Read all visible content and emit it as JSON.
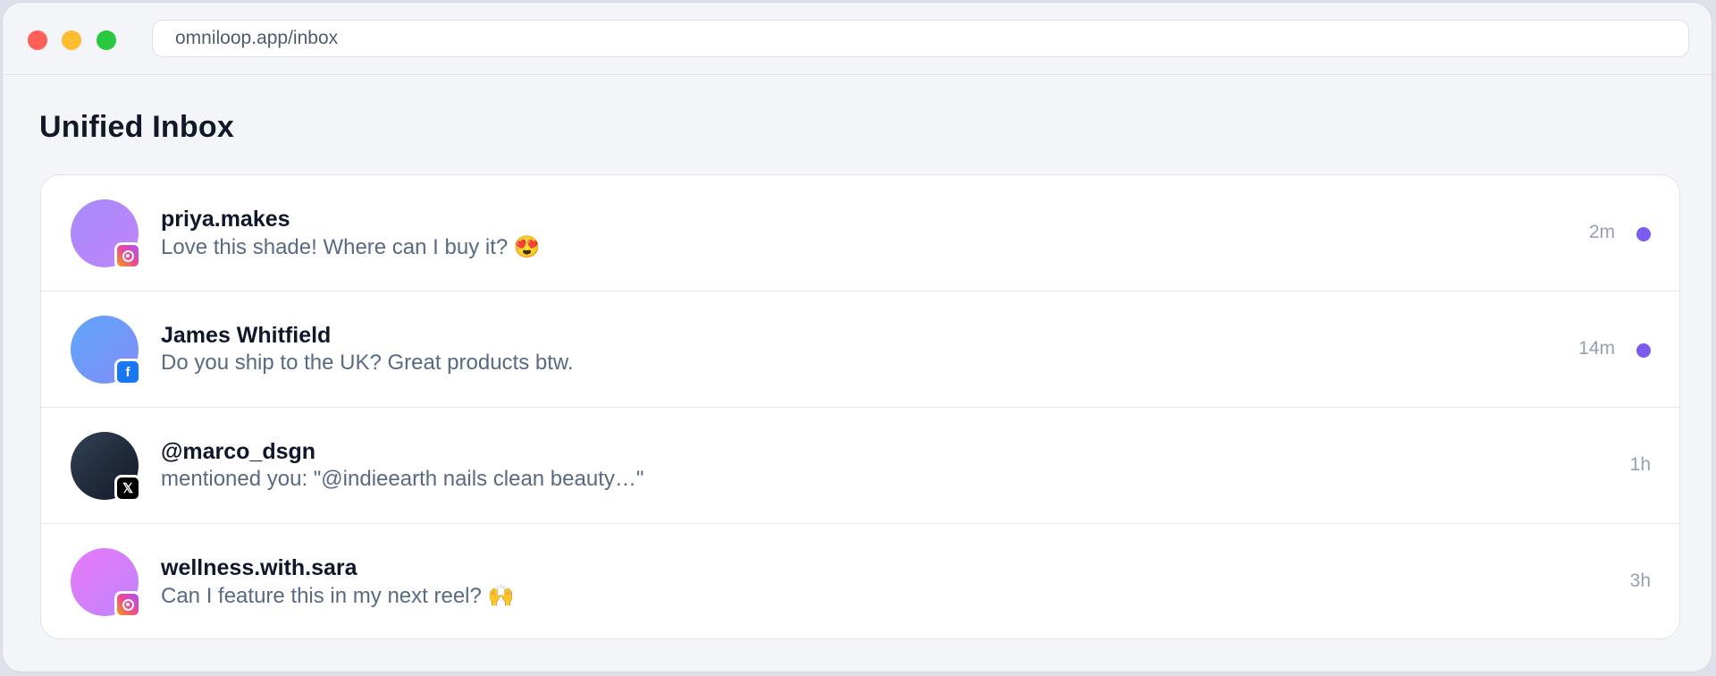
{
  "window": {
    "url": "omniloop.app/inbox"
  },
  "page": {
    "title": "Unified Inbox"
  },
  "colors": {
    "unread_dot": "#7c5cf0",
    "instagram": "#e1306c",
    "facebook": "#1877f2",
    "x": "#000000"
  },
  "messages": [
    {
      "name": "priya.makes",
      "text": "Love this shade! Where can I buy it? 😍",
      "time": "2m",
      "platform": "instagram",
      "platform_icon": "instagram-icon",
      "unread": true,
      "avatar_colors": [
        "#a78bfa",
        "#c084fc"
      ]
    },
    {
      "name": "James Whitfield",
      "text": "Do you ship to the UK? Great products btw.",
      "time": "14m",
      "platform": "facebook",
      "platform_icon": "facebook-icon",
      "badge_glyph": "f",
      "unread": true,
      "avatar_colors": [
        "#60a5fa",
        "#818cf8"
      ]
    },
    {
      "name": "@marco_dsgn",
      "text": "mentioned you: \"@indieearth nails clean beauty…\"",
      "time": "1h",
      "platform": "x",
      "platform_icon": "x-icon",
      "badge_glyph": "𝕏",
      "unread": false,
      "avatar_colors": [
        "#334155",
        "#111827"
      ]
    },
    {
      "name": "wellness.with.sara",
      "text": "Can I feature this in my next reel? 🙌",
      "time": "3h",
      "platform": "instagram",
      "platform_icon": "instagram-icon",
      "unread": false,
      "avatar_colors": [
        "#e879f9",
        "#c084fc"
      ]
    }
  ]
}
